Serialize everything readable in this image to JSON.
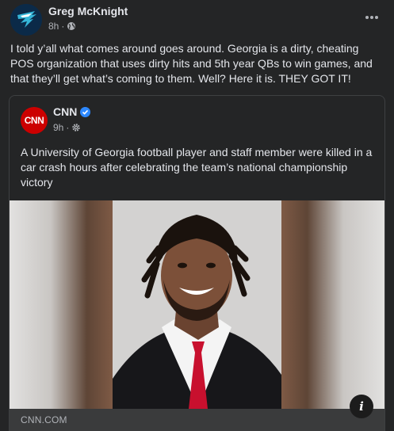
{
  "post": {
    "author": "Greg McKnight",
    "time": "8h",
    "separator": "·",
    "text": "I told y’all what comes around goes around. Georgia is a dirty, cheating POS organization that uses dirty hits and 5th year QBs to win games, and that they’ll get what’s coming to them. Well? Here it is. THEY GOT IT!",
    "audience_icon": "globe-icon",
    "more_icon": "more-horizontal-icon"
  },
  "shared": {
    "page_name": "CNN",
    "avatar_text": "CNN",
    "verified_icon": "verified-badge-icon",
    "time": "9h",
    "separator": "·",
    "audience_icon": "gear-icon",
    "headline": "A University of Georgia football player and staff member were killed in a car crash hours after celebrating the team’s national championship victory",
    "link_domain": "CNN.COM",
    "info_icon": "i"
  },
  "colors": {
    "background": "#242526",
    "text": "#e4e6eb",
    "secondary_text": "#b0b3b8",
    "cnn_red": "#cc0000",
    "verified_blue": "#2d88ff"
  }
}
